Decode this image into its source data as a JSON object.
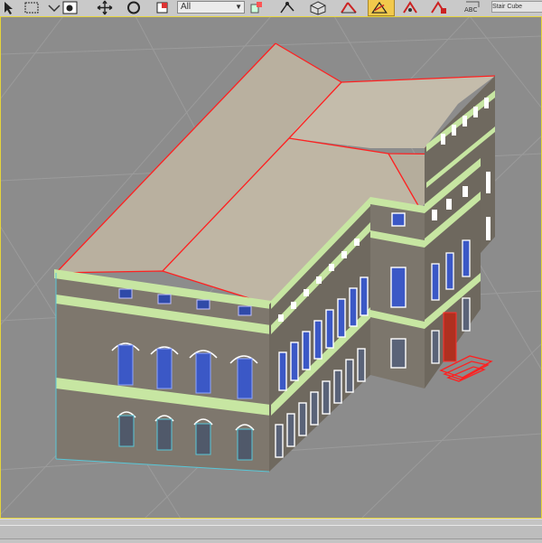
{
  "toolbar": {
    "selection_filter": "All",
    "text_tool_label": "ABC",
    "named_selection_value": "Stair Cube",
    "icons": [
      "select-icon",
      "select-region-icon",
      "select-by-name-icon",
      "select-move-icon",
      "select-rotate-icon",
      "select-scale-icon",
      "snap-toggle-icon",
      "angle-snap-icon",
      "percent-snap-icon",
      "spinner-snap-icon",
      "text-tool-icon"
    ]
  },
  "viewport": {
    "active": true,
    "grid": true,
    "background_color": "#8c8c8c",
    "grid_color": "#9d9d9d"
  },
  "model": {
    "roof_color": "#b7ad9d",
    "wall_color": "#7d766c",
    "cornice_color": "#c7e6a2",
    "window_color": "#3b58c6",
    "selection_edge_color": "#ff2020",
    "stair_color": "#e02020"
  },
  "statusbar": {
    "timeline_visible": true
  }
}
